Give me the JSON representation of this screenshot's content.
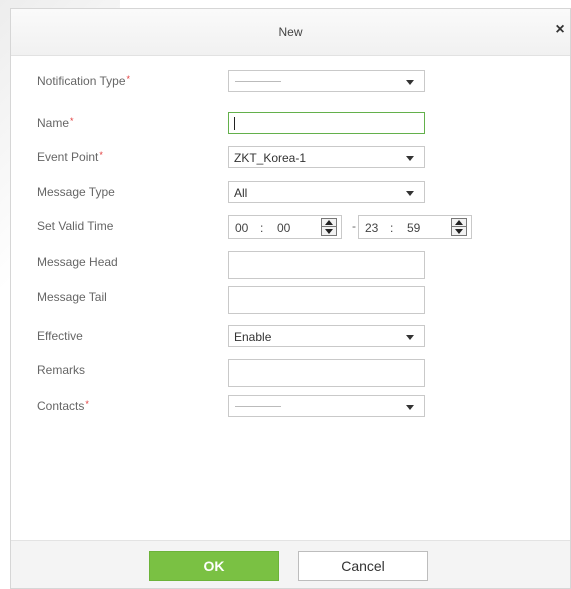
{
  "dialog": {
    "title": "New",
    "close_symbol": "×"
  },
  "form": {
    "notification_type": {
      "label": "Notification Type",
      "required_mark": "*",
      "value": ""
    },
    "name": {
      "label": "Name",
      "required_mark": "*",
      "value": ""
    },
    "event_point": {
      "label": "Event Point",
      "required_mark": "*",
      "value": "ZKT_Korea-1"
    },
    "message_type": {
      "label": "Message Type",
      "value": "All"
    },
    "valid_time": {
      "label": "Set Valid Time",
      "start": {
        "hh": "00",
        "mm": "00"
      },
      "end": {
        "hh": "23",
        "mm": "59"
      },
      "colon": ":",
      "separator": "-"
    },
    "message_head": {
      "label": "Message Head",
      "value": ""
    },
    "message_tail": {
      "label": "Message Tail",
      "value": ""
    },
    "effective": {
      "label": "Effective",
      "value": "Enable"
    },
    "remarks": {
      "label": "Remarks",
      "value": ""
    },
    "contacts": {
      "label": "Contacts",
      "required_mark": "*",
      "value": ""
    }
  },
  "buttons": {
    "ok": "OK",
    "cancel": "Cancel"
  },
  "colors": {
    "ok_green": "#7ac143",
    "active_border": "#63b04b",
    "required_red": "#e23a3a"
  },
  "icons": {
    "close": "close-icon",
    "dropdown": "chevron-down-icon",
    "spinner": "spinner-updown-icon"
  }
}
